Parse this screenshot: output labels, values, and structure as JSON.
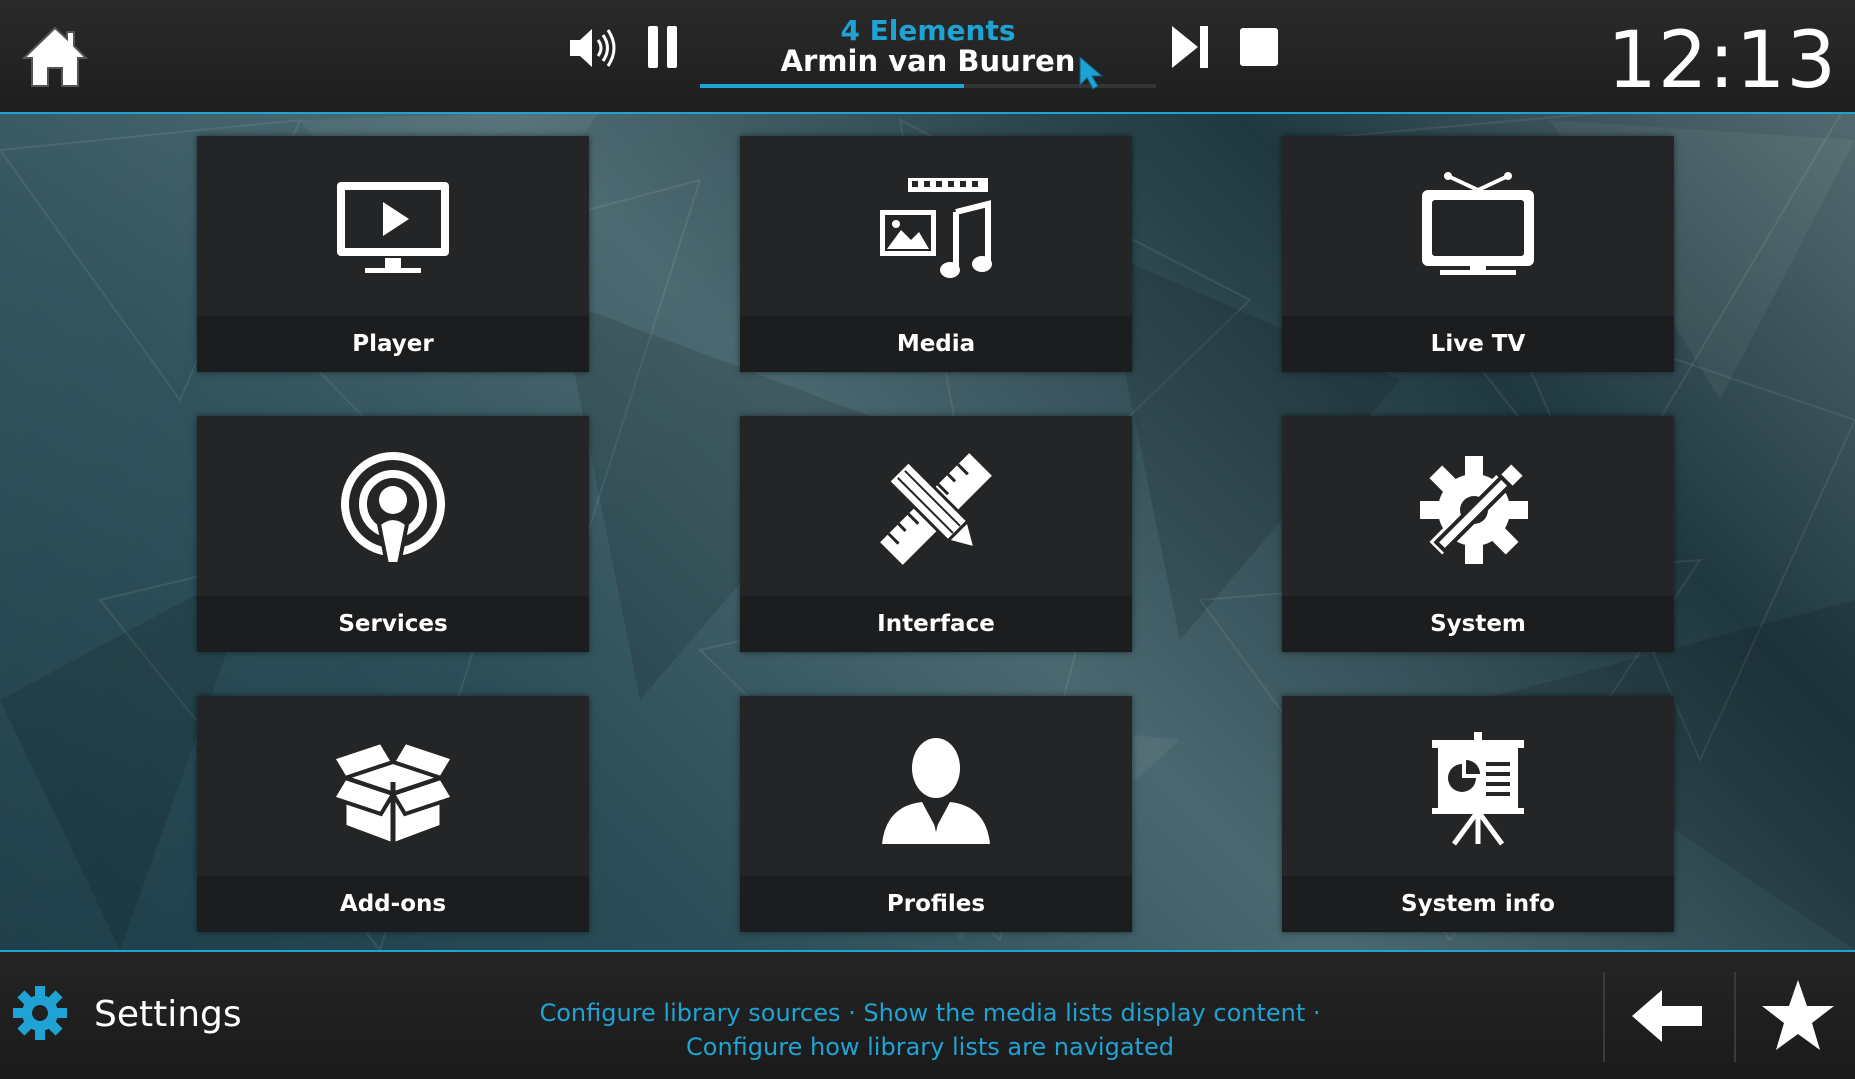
{
  "now_playing": {
    "title": "4 Elements",
    "artist": "Armin van Buuren",
    "progress": 0.58
  },
  "clock": "12:13",
  "tiles": [
    {
      "label": "Player",
      "icon": "monitor-play-icon"
    },
    {
      "label": "Media",
      "icon": "media-icon"
    },
    {
      "label": "Live TV",
      "icon": "tv-icon"
    },
    {
      "label": "Services",
      "icon": "podcast-icon"
    },
    {
      "label": "Interface",
      "icon": "ruler-pencil-icon"
    },
    {
      "label": "System",
      "icon": "gear-wrench-icon"
    },
    {
      "label": "Add-ons",
      "icon": "box-icon"
    },
    {
      "label": "Profiles",
      "icon": "user-icon"
    },
    {
      "label": "System info",
      "icon": "presentation-icon"
    }
  ],
  "footer": {
    "section_title": "Settings",
    "hint_line1": "Configure library sources · Show the media lists display content ·",
    "hint_line2": "Configure how library lists are navigated"
  },
  "colors": {
    "accent": "#1fa3d4",
    "tile_bg": "#232526",
    "bar_bg": "#1e1e1e"
  }
}
